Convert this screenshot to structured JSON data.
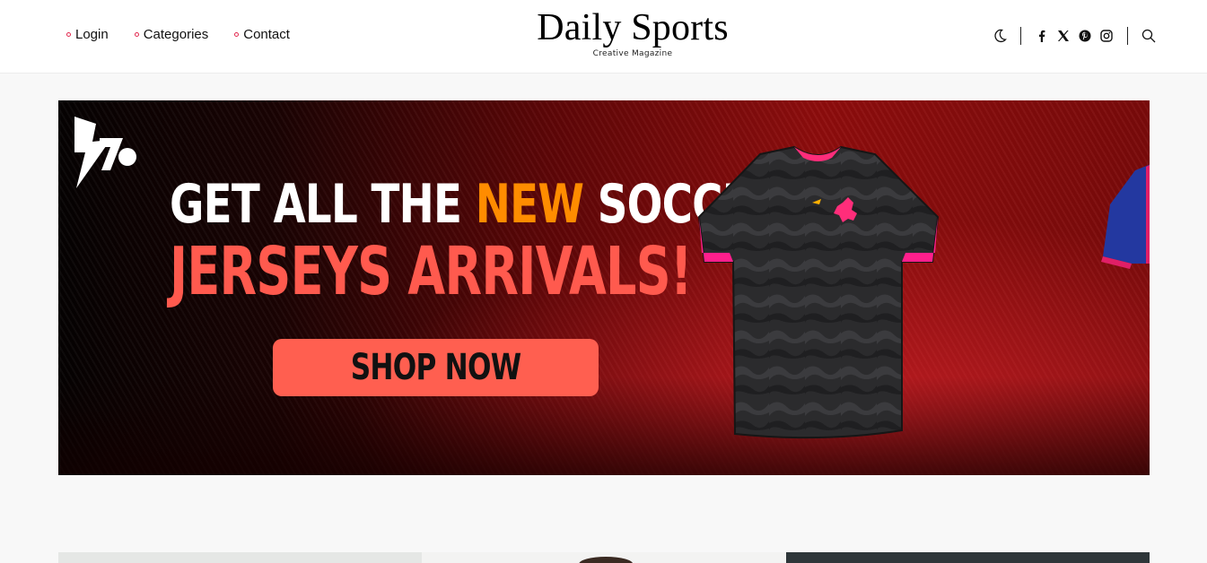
{
  "nav": {
    "items": [
      {
        "label": "Login"
      },
      {
        "label": "Categories"
      },
      {
        "label": "Contact"
      }
    ]
  },
  "brand": {
    "title": "Daily Sports",
    "tagline": "Creative Magazine"
  },
  "tools": {
    "icons": [
      "moon-icon",
      "facebook-icon",
      "x-icon",
      "pinterest-icon",
      "instagram-icon",
      "search-icon"
    ]
  },
  "banner": {
    "headline_part1": "GET ALL THE ",
    "headline_accent": "NEW",
    "headline_part2": " SOCCER",
    "headline_line2": "JERSEYS ARRIVALS!",
    "cta_label": "SHOP NOW",
    "colors": {
      "accent": "#ff8c00",
      "highlight": "#ff5a4e",
      "button": "#ff5f50"
    }
  },
  "colors": {
    "nav_dot": "#e2294f",
    "page_bg": "#f8f8f8"
  }
}
